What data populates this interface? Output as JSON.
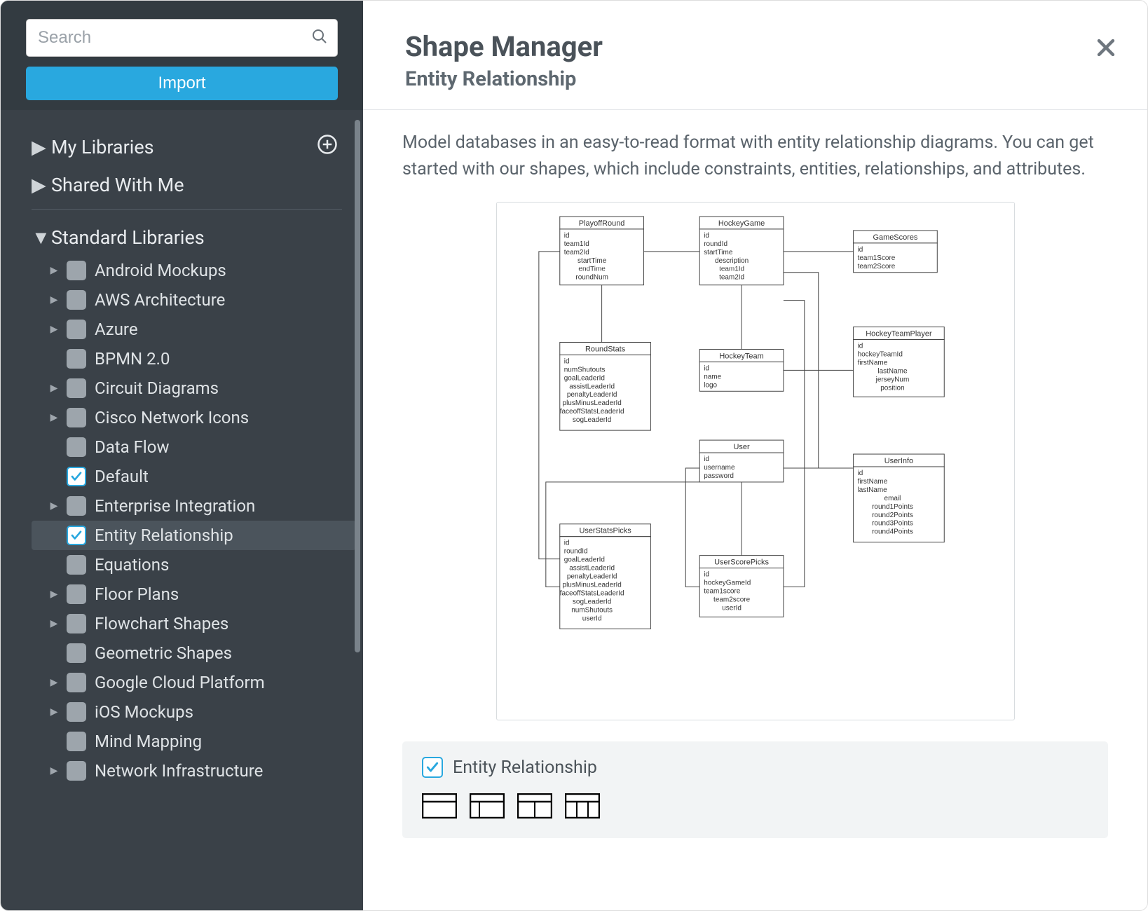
{
  "sidebar": {
    "search_placeholder": "Search",
    "import_label": "Import",
    "sections": {
      "my_libraries": "My Libraries",
      "shared_with_me": "Shared With Me",
      "standard_libraries": "Standard Libraries"
    },
    "libraries": [
      {
        "label": "Android Mockups",
        "checked": false,
        "expandable": true,
        "selected": false
      },
      {
        "label": "AWS Architecture",
        "checked": false,
        "expandable": true,
        "selected": false
      },
      {
        "label": "Azure",
        "checked": false,
        "expandable": true,
        "selected": false
      },
      {
        "label": "BPMN 2.0",
        "checked": false,
        "expandable": false,
        "selected": false
      },
      {
        "label": "Circuit Diagrams",
        "checked": false,
        "expandable": true,
        "selected": false
      },
      {
        "label": "Cisco Network Icons",
        "checked": false,
        "expandable": true,
        "selected": false
      },
      {
        "label": "Data Flow",
        "checked": false,
        "expandable": false,
        "selected": false
      },
      {
        "label": "Default",
        "checked": true,
        "expandable": false,
        "selected": false
      },
      {
        "label": "Enterprise Integration",
        "checked": false,
        "expandable": true,
        "selected": false
      },
      {
        "label": "Entity Relationship",
        "checked": true,
        "expandable": false,
        "selected": true
      },
      {
        "label": "Equations",
        "checked": false,
        "expandable": false,
        "selected": false
      },
      {
        "label": "Floor Plans",
        "checked": false,
        "expandable": true,
        "selected": false
      },
      {
        "label": "Flowchart Shapes",
        "checked": false,
        "expandable": true,
        "selected": false
      },
      {
        "label": "Geometric Shapes",
        "checked": false,
        "expandable": false,
        "selected": false
      },
      {
        "label": "Google Cloud Platform",
        "checked": false,
        "expandable": true,
        "selected": false
      },
      {
        "label": "iOS Mockups",
        "checked": false,
        "expandable": true,
        "selected": false
      },
      {
        "label": "Mind Mapping",
        "checked": false,
        "expandable": false,
        "selected": false
      },
      {
        "label": "Network Infrastructure",
        "checked": false,
        "expandable": true,
        "selected": false
      }
    ]
  },
  "main": {
    "title": "Shape Manager",
    "subtitle": "Entity Relationship",
    "description": "Model databases in an easy-to-read format with entity relationship diagrams. You can get started with our shapes, which include constraints, entities, relationships, and attributes.",
    "shape_group_title": "Entity Relationship",
    "diagram_entities": {
      "PlayoffRound": [
        "id",
        "team1Id",
        "team2Id",
        "startTime",
        "endTime",
        "roundNum"
      ],
      "HockeyGame": [
        "id",
        "roundId",
        "startTime",
        "description",
        "team1Id",
        "team2Id"
      ],
      "GameScores": [
        "id",
        "team1Score",
        "team2Score"
      ],
      "RoundStats": [
        "id",
        "numShutouts",
        "goalLeaderId",
        "assistLeaderId",
        "penaltyLeaderId",
        "plusMinusLeaderId",
        "faceoffStatsLeaderId",
        "sogLeaderId"
      ],
      "HockeyTeam": [
        "id",
        "name",
        "logo"
      ],
      "HockeyTeamPlayer": [
        "id",
        "hockeyTeamId",
        "firstName",
        "lastName",
        "jerseyNum",
        "position"
      ],
      "User": [
        "id",
        "username",
        "password"
      ],
      "UserInfo": [
        "id",
        "firstName",
        "lastName",
        "email",
        "round1Points",
        "round2Points",
        "round3Points",
        "round4Points"
      ],
      "UserStatsPicks": [
        "id",
        "roundId",
        "goalLeaderId",
        "assistLeaderId",
        "penaltyLeaderId",
        "plusMinusLeaderId",
        "faceoffStatsLeaderId",
        "sogLeaderId",
        "numShutouts",
        "userId"
      ],
      "UserScorePicks": [
        "id",
        "hockeyGameId",
        "team1score",
        "team2score",
        "userId"
      ]
    }
  }
}
